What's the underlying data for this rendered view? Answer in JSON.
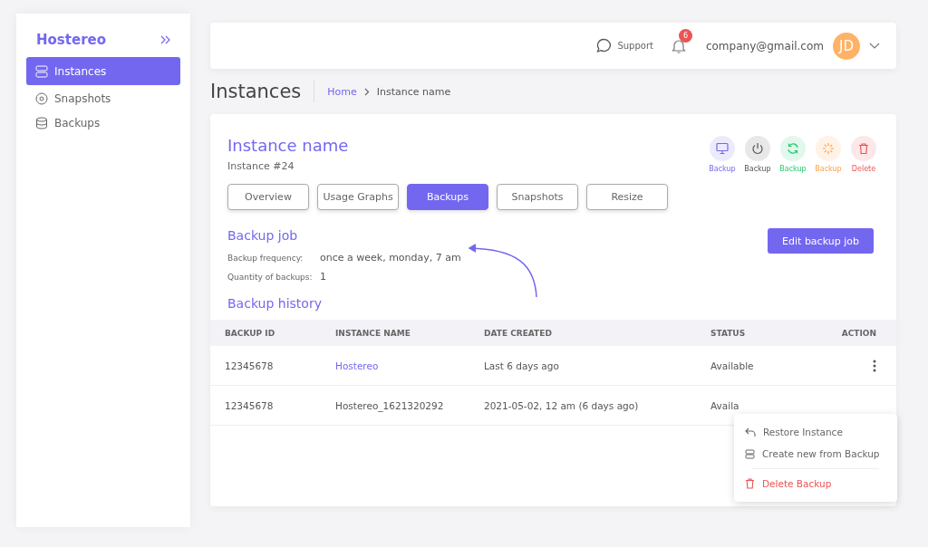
{
  "sidebar": {
    "logo": "Hostereo",
    "items": [
      {
        "label": "Instances",
        "kind": "server",
        "selected": true
      },
      {
        "label": "Snapshots",
        "kind": "disc",
        "selected": false
      },
      {
        "label": "Backups",
        "kind": "database",
        "selected": false
      }
    ]
  },
  "topbar": {
    "support": "Support",
    "notifications": "6",
    "email": "company@gmail.com",
    "avatar": "JD"
  },
  "page": {
    "title": "Instances",
    "breadcrumb": [
      "Home",
      "Instance name"
    ]
  },
  "instance": {
    "name": "Instance name",
    "number": "Instance #24",
    "actions": [
      {
        "kind": "monitor",
        "label": "Backup",
        "color": "#7367f0"
      },
      {
        "kind": "power",
        "label": "Backup",
        "color": "#555555"
      },
      {
        "kind": "refresh",
        "label": "Backup",
        "color": "#28c76f"
      },
      {
        "kind": "loader",
        "label": "Backup",
        "color": "#ff9f43"
      },
      {
        "kind": "trash",
        "label": "Delete",
        "color": "#ea5455"
      }
    ],
    "tabs": [
      {
        "label": "Overview",
        "selected": false
      },
      {
        "label": "Usage Graphs",
        "selected": false
      },
      {
        "label": "Backups",
        "selected": true
      },
      {
        "label": "Snapshots",
        "selected": false
      },
      {
        "label": "Resize",
        "selected": false
      }
    ]
  },
  "backup_job": {
    "title": "Backup job",
    "button": "Edit backup job",
    "fields": [
      {
        "label": "Backup frequency:",
        "value": "once a week, monday, 7 am"
      },
      {
        "label": "Quantity of backups:",
        "value": "1"
      }
    ]
  },
  "backup_history": {
    "title": "Backup history",
    "columns": [
      "BACKUP ID",
      "INSTANCE NAME",
      "DATE CREATED",
      "STATUS",
      "ACTION"
    ],
    "rows": [
      {
        "id": "12345678",
        "instance": "Hostereo",
        "instance_link": true,
        "date": "Last 6 days ago",
        "status": "Available"
      },
      {
        "id": "12345678",
        "instance": "Hostereo_1621320292",
        "instance_link": false,
        "date": "2021-05-02, 12 am (6 days ago)",
        "status": "Availa"
      }
    ]
  },
  "context_menu": {
    "items": [
      {
        "kind": "restore",
        "label": "Restore Instance"
      },
      {
        "kind": "create",
        "label": "Create new from Backup"
      },
      {
        "kind": "delete",
        "label": "Delete Backup"
      }
    ]
  }
}
